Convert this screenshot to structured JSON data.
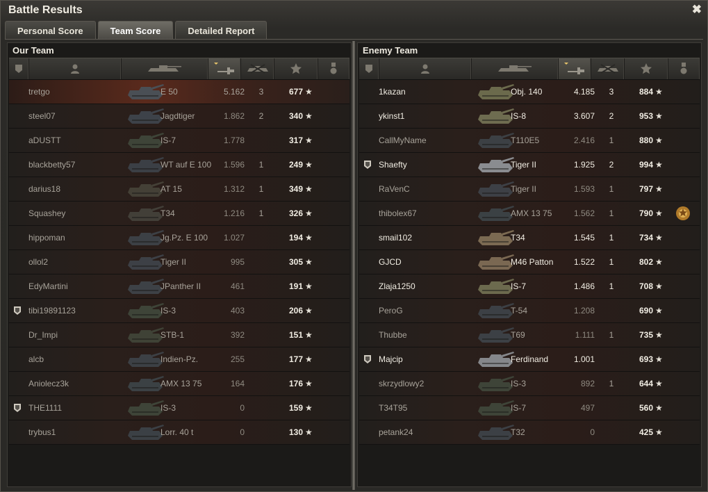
{
  "window": {
    "title": "Battle Results",
    "close_glyph": "✖"
  },
  "tabs": [
    {
      "label": "Personal Score",
      "active": false
    },
    {
      "label": "Team Score",
      "active": true
    },
    {
      "label": "Detailed Report",
      "active": false
    }
  ],
  "columns": [
    "squad-icon",
    "player-icon",
    "tank-icon",
    "damage-icon",
    "kills-icon",
    "star-icon",
    "medal-icon"
  ],
  "our_team": {
    "title": "Our Team",
    "rows": [
      {
        "player": "tretgo",
        "tank": "E 50",
        "damage": "5.162",
        "kills": "3",
        "xp": "677",
        "squad": false,
        "highlight": true,
        "bright": false,
        "tank_color": "#4a4f55"
      },
      {
        "player": "steel07",
        "tank": "Jagdtiger",
        "damage": "1.862",
        "kills": "2",
        "xp": "340",
        "squad": false,
        "highlight": false,
        "bright": false,
        "tank_color": "#3d4249"
      },
      {
        "player": "aDUSTT",
        "tank": "IS-7",
        "damage": "1.778",
        "kills": "",
        "xp": "317",
        "squad": false,
        "highlight": false,
        "bright": false,
        "tank_color": "#3e4438"
      },
      {
        "player": "blackbetty57",
        "tank": "WT auf E 100",
        "damage": "1.596",
        "kills": "1",
        "xp": "249",
        "squad": false,
        "highlight": false,
        "bright": false,
        "tank_color": "#3b3f45"
      },
      {
        "player": "darius18",
        "tank": "AT 15",
        "damage": "1.312",
        "kills": "1",
        "xp": "349",
        "squad": false,
        "highlight": false,
        "bright": false,
        "tank_color": "#444036"
      },
      {
        "player": "Squashey",
        "tank": "T34",
        "damage": "1.216",
        "kills": "1",
        "xp": "326",
        "squad": false,
        "highlight": false,
        "bright": false,
        "tank_color": "#423f38"
      },
      {
        "player": "hippoman",
        "tank": "Jg.Pz. E 100",
        "damage": "1.027",
        "kills": "",
        "xp": "194",
        "squad": false,
        "highlight": false,
        "bright": false,
        "tank_color": "#3c4045"
      },
      {
        "player": "ollol2",
        "tank": "Tiger II",
        "damage": "995",
        "kills": "",
        "xp": "305",
        "squad": false,
        "highlight": false,
        "bright": false,
        "tank_color": "#3d4046"
      },
      {
        "player": "EdyMartini",
        "tank": "JPanther II",
        "damage": "461",
        "kills": "",
        "xp": "191",
        "squad": false,
        "highlight": false,
        "bright": false,
        "tank_color": "#3d4146"
      },
      {
        "player": "tibi19891123",
        "tank": "IS-3",
        "damage": "403",
        "kills": "",
        "xp": "206",
        "squad": true,
        "highlight": false,
        "bright": false,
        "tank_color": "#3e4438"
      },
      {
        "player": "Dr_Impi",
        "tank": "STB-1",
        "damage": "392",
        "kills": "",
        "xp": "151",
        "squad": false,
        "highlight": false,
        "bright": false,
        "tank_color": "#3f4236"
      },
      {
        "player": "alcb",
        "tank": "Indien-Pz.",
        "damage": "255",
        "kills": "",
        "xp": "177",
        "squad": false,
        "highlight": false,
        "bright": false,
        "tank_color": "#3c4045"
      },
      {
        "player": "Aniolecz3k",
        "tank": "AMX 13 75",
        "damage": "164",
        "kills": "",
        "xp": "176",
        "squad": false,
        "highlight": false,
        "bright": false,
        "tank_color": "#3b4144"
      },
      {
        "player": "THE1111",
        "tank": "IS-3",
        "damage": "0",
        "kills": "",
        "xp": "159",
        "squad": true,
        "highlight": false,
        "bright": false,
        "tank_color": "#3e4438"
      },
      {
        "player": "trybus1",
        "tank": "Lorr. 40 t",
        "damage": "0",
        "kills": "",
        "xp": "130",
        "squad": false,
        "highlight": false,
        "bright": false,
        "tank_color": "#3b4045"
      }
    ]
  },
  "enemy_team": {
    "title": "Enemy Team",
    "rows": [
      {
        "player": "1kazan",
        "tank": "Obj. 140",
        "damage": "4.185",
        "kills": "3",
        "xp": "884",
        "squad": false,
        "highlight": false,
        "bright": true,
        "tank_color": "#6b6a4c"
      },
      {
        "player": "ykinst1",
        "tank": "IS-8",
        "damage": "3.607",
        "kills": "2",
        "xp": "953",
        "squad": false,
        "highlight": false,
        "bright": true,
        "tank_color": "#6e6c50"
      },
      {
        "player": "CallMyName",
        "tank": "T110E5",
        "damage": "2.416",
        "kills": "1",
        "xp": "880",
        "squad": false,
        "highlight": false,
        "bright": false,
        "tank_color": "#3c4044"
      },
      {
        "player": "Shaefty",
        "tank": "Tiger II",
        "damage": "1.925",
        "kills": "2",
        "xp": "994",
        "squad": true,
        "highlight": false,
        "bright": true,
        "tank_color": "#8a8c90"
      },
      {
        "player": "RaVenC",
        "tank": "Tiger II",
        "damage": "1.593",
        "kills": "1",
        "xp": "797",
        "squad": false,
        "highlight": false,
        "bright": false,
        "tank_color": "#3d4046"
      },
      {
        "player": "thibolex67",
        "tank": "AMX 13 75",
        "damage": "1.562",
        "kills": "1",
        "xp": "790",
        "squad": false,
        "highlight": false,
        "bright": false,
        "tank_color": "#3b4144",
        "medal": true
      },
      {
        "player": "smail102",
        "tank": "T34",
        "damage": "1.545",
        "kills": "1",
        "xp": "734",
        "squad": false,
        "highlight": false,
        "bright": true,
        "tank_color": "#7b6a52"
      },
      {
        "player": "GJCD",
        "tank": "M46 Patton",
        "damage": "1.522",
        "kills": "1",
        "xp": "802",
        "squad": false,
        "highlight": false,
        "bright": true,
        "tank_color": "#7a6852"
      },
      {
        "player": "Zlaja1250",
        "tank": "IS-7",
        "damage": "1.486",
        "kills": "1",
        "xp": "708",
        "squad": false,
        "highlight": false,
        "bright": true,
        "tank_color": "#6c6a4e"
      },
      {
        "player": "PeroG",
        "tank": "T-54",
        "damage": "1.208",
        "kills": "",
        "xp": "690",
        "squad": false,
        "highlight": false,
        "bright": false,
        "tank_color": "#3c4045"
      },
      {
        "player": "Thubbe",
        "tank": "T69",
        "damage": "1.111",
        "kills": "1",
        "xp": "735",
        "squad": false,
        "highlight": false,
        "bright": false,
        "tank_color": "#3c4045"
      },
      {
        "player": "Majcip",
        "tank": "Ferdinand",
        "damage": "1.001",
        "kills": "",
        "xp": "693",
        "squad": true,
        "highlight": false,
        "bright": true,
        "tank_color": "#85878b"
      },
      {
        "player": "skrzydlowy2",
        "tank": "IS-3",
        "damage": "892",
        "kills": "1",
        "xp": "644",
        "squad": false,
        "highlight": false,
        "bright": false,
        "tank_color": "#3e4438"
      },
      {
        "player": "T34T95",
        "tank": "IS-7",
        "damage": "497",
        "kills": "",
        "xp": "560",
        "squad": false,
        "highlight": false,
        "bright": false,
        "tank_color": "#3e4438"
      },
      {
        "player": "petank24",
        "tank": "T32",
        "damage": "0",
        "kills": "",
        "xp": "425",
        "squad": false,
        "highlight": false,
        "bright": false,
        "tank_color": "#3c4045"
      }
    ]
  }
}
